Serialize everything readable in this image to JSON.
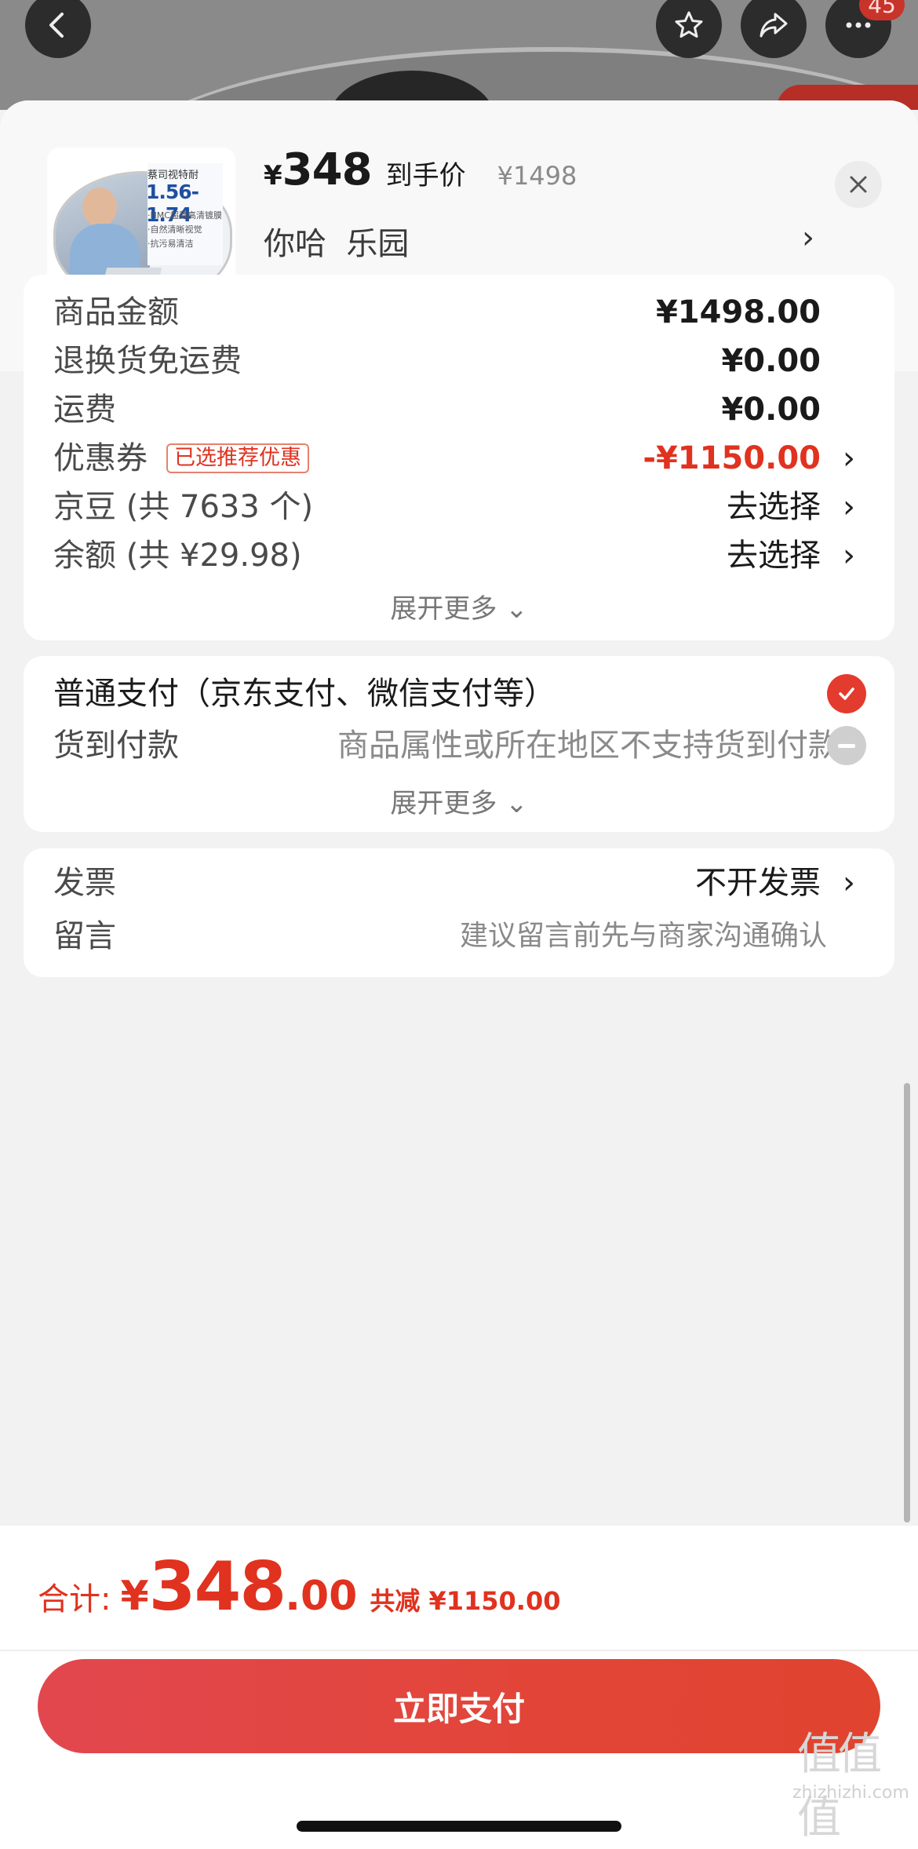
{
  "topbar": {
    "notification_count": "45",
    "icons": [
      "back-icon",
      "star-icon",
      "share-icon",
      "more-icon"
    ]
  },
  "product": {
    "yen": "¥",
    "price": "348",
    "price_tag": "到手价",
    "original_price": "¥1498",
    "spec": "你哈  乐园",
    "arrow": "›",
    "thumb": {
      "brand": "蔡司视特耐",
      "index": "1.56-1.74",
      "features": [
        "·HMC超薄高清镀膜",
        "·自然清晰视觉",
        "·抗污易清洁"
      ]
    }
  },
  "costs": {
    "rows": [
      {
        "label": "商品金额",
        "value": "¥1498.00"
      },
      {
        "label": "退换货免运费",
        "value": "¥0.00"
      },
      {
        "label": "运费",
        "value": "¥0.00"
      },
      {
        "label": "优惠券",
        "chip": "已选推荐优惠",
        "value": "-¥1150.00"
      },
      {
        "label": "京豆 (共 7633 个)",
        "value": "去选择"
      },
      {
        "label": "余额 (共 ¥29.98)",
        "value": "去选择"
      }
    ],
    "expand": "展开更多 ⌄"
  },
  "payment": {
    "normal": "普通支付（京东支付、微信支付等）",
    "cod_label": "货到付款",
    "cod_note": "商品属性或所在地区不支持货到付款",
    "expand": "展开更多 ⌄"
  },
  "extra": {
    "invoice_label": "发票",
    "invoice_value": "不开发票",
    "message_label": "留言",
    "message_placeholder": "建议留言前先与商家沟通确认"
  },
  "total": {
    "label": "合计:",
    "yen": "¥",
    "integer": "348",
    "decimal": ".00",
    "discount": "共减 ¥1150.00"
  },
  "pay_button": "立即支付",
  "watermark": {
    "glyphs": "值值值",
    "site": "zhizhizhi.com"
  },
  "colors": {
    "accent": "#e0321f",
    "button": "#e24537",
    "background": "#f2f2f2"
  }
}
